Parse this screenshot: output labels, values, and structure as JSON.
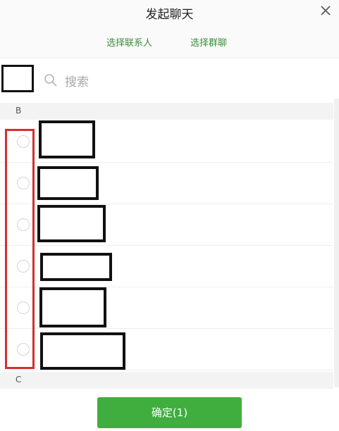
{
  "header": {
    "title": "发起聊天",
    "close_icon": "close-icon"
  },
  "tabs": [
    {
      "label": "选择联系人"
    },
    {
      "label": "选择群聊"
    }
  ],
  "search": {
    "placeholder": "搜索",
    "icon": "search-icon"
  },
  "sections": [
    {
      "letter": "B"
    },
    {
      "letter": "C"
    }
  ],
  "contacts_count": 6,
  "confirm_button": {
    "label": "确定(1)"
  },
  "colors": {
    "accent_green": "#3fae3f",
    "tab_green": "#3a8f3a",
    "highlight_red": "#d32f2f"
  }
}
